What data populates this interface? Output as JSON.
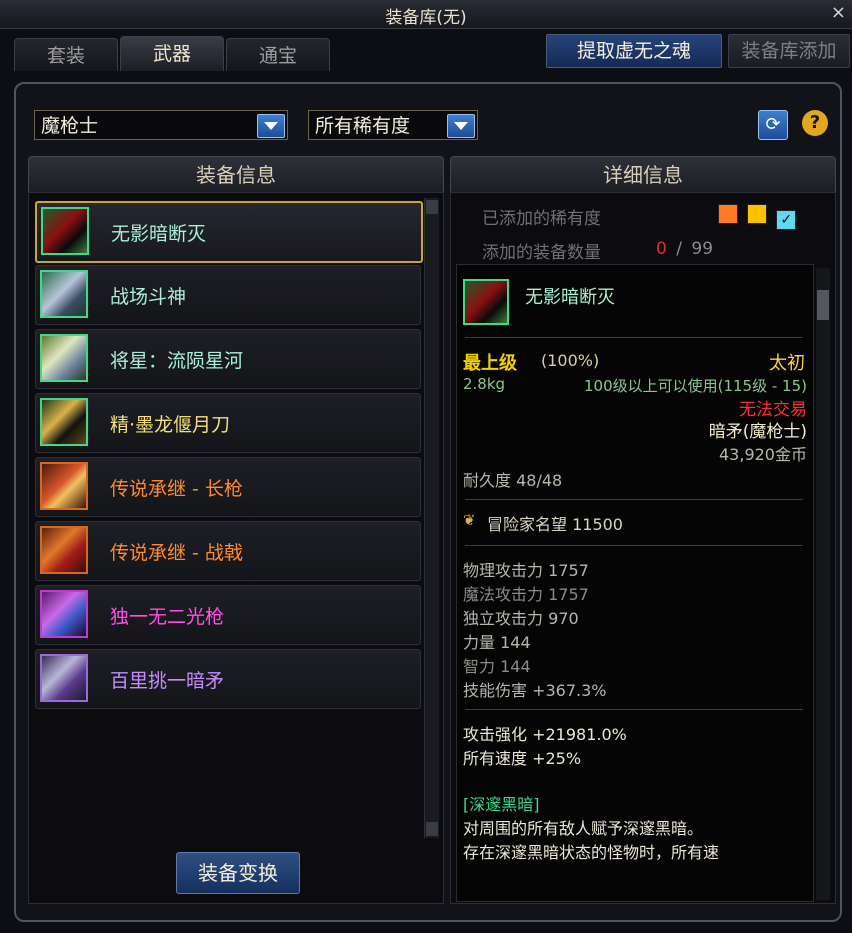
{
  "window": {
    "title": "装备库(无)",
    "close": "×"
  },
  "tabs": [
    {
      "label": "套装",
      "active": false
    },
    {
      "label": "武器",
      "active": true
    },
    {
      "label": "通宝",
      "active": false
    }
  ],
  "top_buttons": {
    "extract": "提取虚无之魂",
    "add": "装备库添加"
  },
  "filters": {
    "class_value": "魔枪士",
    "rarity_value": "所有稀有度"
  },
  "panels": {
    "left_title": "装备信息",
    "right_title": "详细信息"
  },
  "rarity_info": {
    "label": "已添加的稀有度",
    "colors": [
      "#ff7a22",
      "#ffc000",
      "#5fd9f0"
    ],
    "count_label": "添加的装备数量",
    "count_current": "0",
    "count_sep": "/",
    "count_max": "99"
  },
  "items": [
    {
      "name": "无影暗断灭",
      "color": "#a8f0d6",
      "icon": "weapon-icon"
    },
    {
      "name": "战场斗神",
      "color": "#a8f0d6",
      "icon": "weapon-icon"
    },
    {
      "name": "将星：流陨星河",
      "color": "#a8f0d6",
      "icon": "weapon-icon"
    },
    {
      "name": "精·墨龙偃月刀",
      "color": "#f5df7a",
      "icon": "weapon-icon"
    },
    {
      "name": "传说承继 - 长枪",
      "color": "#ff8a2a",
      "icon": "weapon-icon"
    },
    {
      "name": "传说承继 - 战戟",
      "color": "#ff8a2a",
      "icon": "weapon-icon"
    },
    {
      "name": "独一无二光枪",
      "color": "#ff4fe6",
      "icon": "weapon-icon"
    },
    {
      "name": "百里挑一暗矛",
      "color": "#c68cff",
      "icon": "weapon-icon"
    }
  ],
  "swap_button": "装备变换",
  "detail": {
    "name": "无影暗断灭",
    "grade": "最上级",
    "grade_pct": "(100%)",
    "tier": "太初",
    "weight": "2.8kg",
    "level_req": "100级以上可以使用(115级 - 15)",
    "trade": "无法交易",
    "type": "暗矛(魔枪士)",
    "price": "43,920金币",
    "durability": "耐久度 48/48",
    "fame": "冒险家名望 11500",
    "stats": [
      "物理攻击力 1757",
      "魔法攻击力 1757",
      "独立攻击力 970",
      "力量 144",
      "智力 144",
      "技能伤害 +367.3%"
    ],
    "bonus": [
      "攻击强化 +21981.0%",
      "所有速度 +25%"
    ],
    "skill_name": "[深邃黑暗]",
    "skill_desc": [
      "对周围的所有敌人赋予深邃黑暗。",
      "存在深邃黑暗状态的怪物时，所有速"
    ]
  }
}
